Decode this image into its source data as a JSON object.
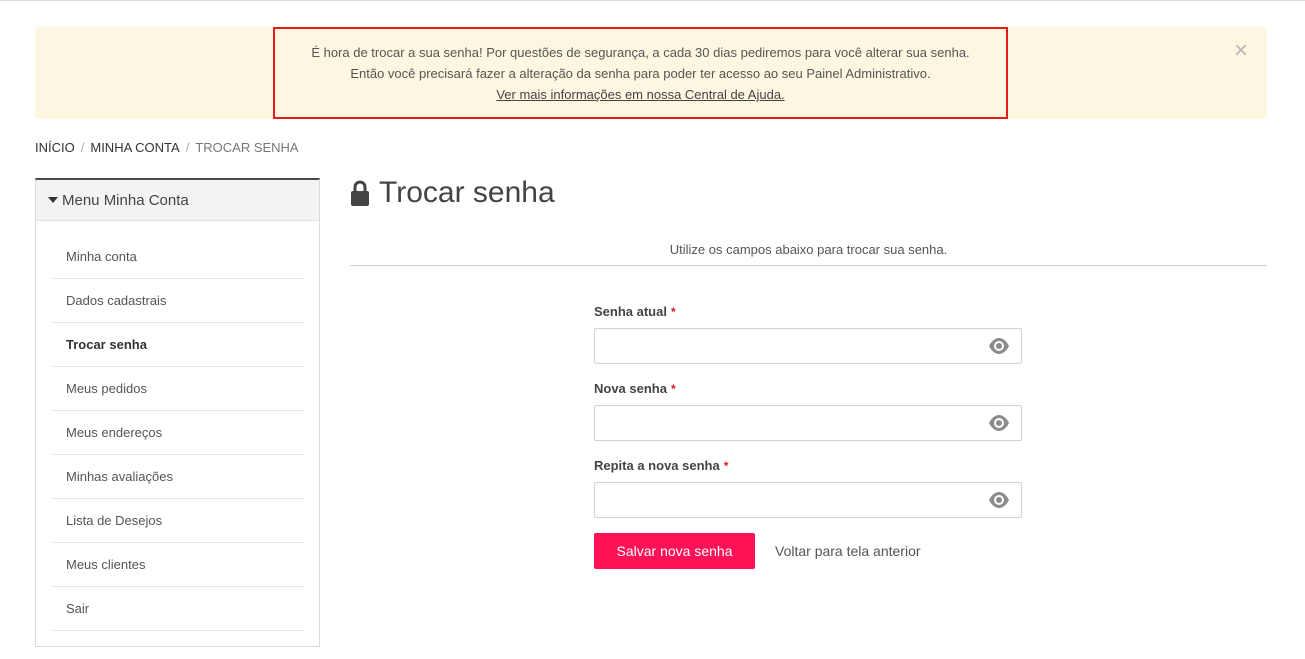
{
  "alert": {
    "line1": "É hora de trocar a sua senha! Por questões de segurança, a cada 30 dias pediremos para você alterar sua senha.",
    "line2": "Então você precisará fazer a alteração da senha para poder ter acesso ao seu Painel Administrativo.",
    "link": "Ver mais informações em nossa Central de Ajuda.",
    "close_label": "×"
  },
  "breadcrumb": {
    "items": [
      "INÍCIO",
      "MINHA CONTA",
      "TROCAR SENHA"
    ],
    "separator": "/"
  },
  "sidebar": {
    "title": "Menu Minha Conta",
    "items": [
      {
        "label": "Minha conta"
      },
      {
        "label": "Dados cadastrais"
      },
      {
        "label": "Trocar senha"
      },
      {
        "label": "Meus pedidos"
      },
      {
        "label": "Meus endereços"
      },
      {
        "label": "Minhas avaliações"
      },
      {
        "label": "Lista de Desejos"
      },
      {
        "label": "Meus clientes"
      },
      {
        "label": "Sair"
      }
    ],
    "active_item": "Trocar senha"
  },
  "main": {
    "title": "Trocar senha",
    "subtitle": "Utilize os campos abaixo para trocar sua senha.",
    "fields": [
      {
        "label": "Senha atual",
        "required_mark": "*",
        "value": ""
      },
      {
        "label": "Nova senha",
        "required_mark": "*",
        "value": ""
      },
      {
        "label": "Repita a nova senha",
        "required_mark": "*",
        "value": ""
      }
    ],
    "save_label": "Salvar nova senha",
    "back_label": "Voltar para tela anterior"
  },
  "colors": {
    "alert_bg": "#fdf6e1",
    "alert_border": "#e21b1b",
    "primary_button": "#ff1155",
    "required": "#e21b1b"
  },
  "icons": {
    "title": "lock-icon",
    "password_toggle": "eye-icon",
    "alert_close": "close-icon",
    "menu_toggle": "caret-down-icon"
  }
}
